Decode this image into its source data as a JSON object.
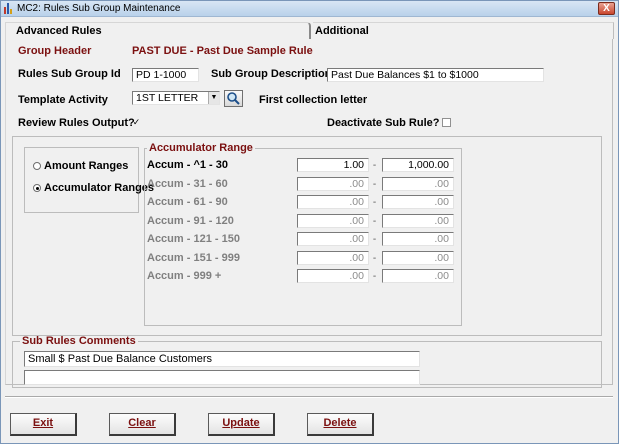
{
  "window": {
    "title": "MC2: Rules Sub Group Maintenance",
    "close_label": "X"
  },
  "tabs": {
    "advanced": "Advanced Rules",
    "additional": "Additional"
  },
  "header": {
    "group_header_label": "Group Header",
    "group_header_value": "PAST DUE - Past Due Sample Rule"
  },
  "form": {
    "sub_group_id_label": "Rules Sub Group Id",
    "sub_group_id_value": "PD 1-1000",
    "sub_group_desc_label": "Sub Group Description",
    "sub_group_desc_value": "Past Due Balances $1 to $1000",
    "template_activity_label": "Template Activity",
    "template_activity_value": "1ST LETTER",
    "template_activity_desc": "First collection letter",
    "review_output_label": "Review Rules Output?",
    "review_output_checked": true,
    "deactivate_label": "Deactivate Sub Rule?",
    "deactivate_checked": false,
    "check_mark": "✓"
  },
  "range_type": {
    "amount_label": "Amount Ranges",
    "accumulator_label": "Accumulator Ranges",
    "selected": "accumulator"
  },
  "accumulator": {
    "title": "Accumulator Range",
    "separator": "-",
    "rows": [
      {
        "label": "Accum - ^1 - 30",
        "from": "1.00",
        "to": "1,000.00",
        "active": true
      },
      {
        "label": "Accum - 31 - 60",
        "from": ".00",
        "to": ".00",
        "active": false
      },
      {
        "label": "Accum - 61 - 90",
        "from": ".00",
        "to": ".00",
        "active": false
      },
      {
        "label": "Accum - 91 - 120",
        "from": ".00",
        "to": ".00",
        "active": false
      },
      {
        "label": "Accum - 121 - 150",
        "from": ".00",
        "to": ".00",
        "active": false
      },
      {
        "label": "Accum - 151 - 999",
        "from": ".00",
        "to": ".00",
        "active": false
      },
      {
        "label": "Accum - 999 +",
        "from": ".00",
        "to": ".00",
        "active": false
      }
    ]
  },
  "comments": {
    "title": "Sub Rules Comments",
    "line1": "Small $ Past Due Balance Customers",
    "line2": ""
  },
  "buttons": {
    "exit": "Exit",
    "clear": "Clear",
    "update": "Update",
    "delete": "Delete"
  },
  "colors": {
    "label_accent": "#7b1010",
    "disabled_text": "#808080"
  }
}
